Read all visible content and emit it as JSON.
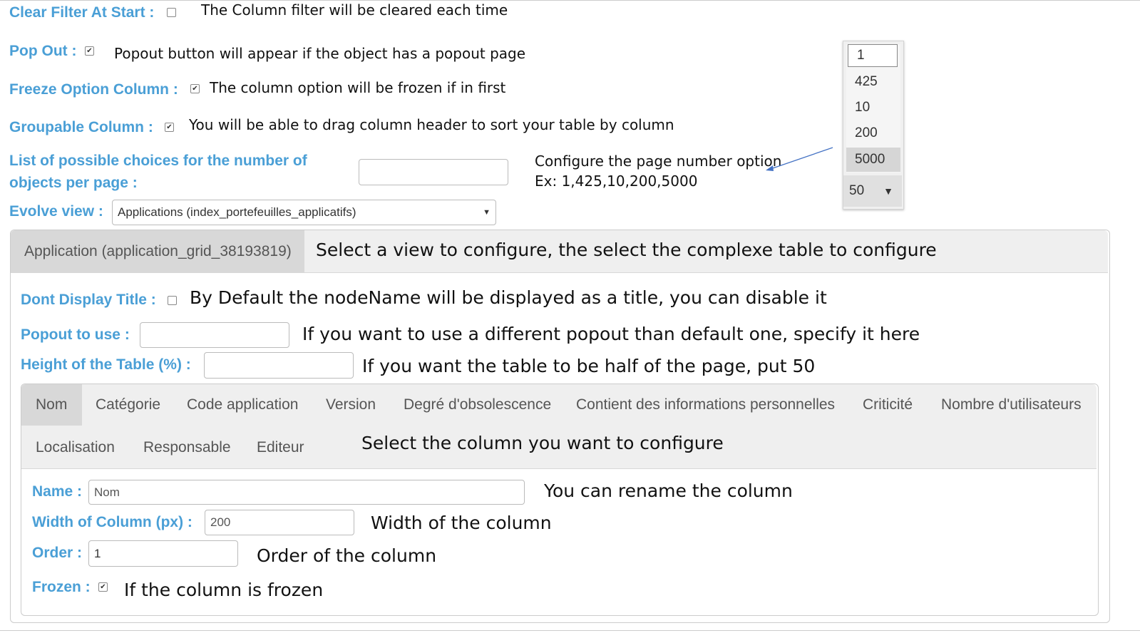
{
  "top_options": {
    "clear_filter": {
      "label": "Clear Filter At Start :",
      "checked": false,
      "note": "The Column filter will be cleared each time"
    },
    "pop_out": {
      "label": "Pop Out :",
      "checked": true,
      "note": "Popout button will appear if the object has a popout page"
    },
    "freeze_option": {
      "label": "Freeze Option Column :",
      "checked": true,
      "note": "The column option will be frozen if in first"
    },
    "groupable": {
      "label": "Groupable Column :",
      "checked": true,
      "note": "You will be able to drag column header to sort your table by column"
    },
    "choices": {
      "label_line1": "List of possible choices for the number of",
      "label_line2": "objects per page :",
      "value": "",
      "note_line1": "Configure the page number option",
      "note_line2": "Ex: 1,425,10,200,5000"
    },
    "evolve_view": {
      "label": "Evolve view :",
      "selected": "Applications (index_portefeuilles_applicatifs)"
    }
  },
  "page_size_dropdown": {
    "options": [
      "1",
      "425",
      "10",
      "200",
      "5000"
    ],
    "selected": "50",
    "highlighted": "5000"
  },
  "table_panel": {
    "tab_label": "Application (application_grid_38193819)",
    "note": "Select a view to configure, the select the complexe table to configure",
    "dont_display_title": {
      "label": "Dont Display Title :",
      "checked": false,
      "note": "By Default the nodeName will be displayed as a title, you can disable it"
    },
    "popout_to_use": {
      "label": "Popout to use :",
      "value": "",
      "note": "If you want to use a different popout than default one, specify it here"
    },
    "height": {
      "label": "Height of the Table (%) :",
      "value": "",
      "note": "If you want the table to be half of the page, put 50"
    }
  },
  "columns_panel": {
    "tabs_row1": [
      "Nom",
      "Catégorie",
      "Code application",
      "Version",
      "Degré d'obsolescence",
      "Contient des informations personnelles",
      "Criticité",
      "Nombre d'utilisateurs"
    ],
    "tabs_row2": [
      "Localisation",
      "Responsable",
      "Editeur"
    ],
    "active_tab": "Nom",
    "note": "Select the column you want to configure",
    "name": {
      "label": "Name :",
      "value": "Nom",
      "note": "You can rename the column"
    },
    "width": {
      "label": "Width of Column (px) :",
      "value": "200",
      "note": "Width of the column"
    },
    "order": {
      "label": "Order :",
      "value": "1",
      "note": "Order of the column"
    },
    "frozen": {
      "label": "Frozen :",
      "checked": true,
      "note": "If the column is frozen"
    }
  },
  "colors": {
    "label_blue": "#4a9fd6",
    "panel_gray": "#efefef",
    "tab_active": "#d8d8d8"
  }
}
